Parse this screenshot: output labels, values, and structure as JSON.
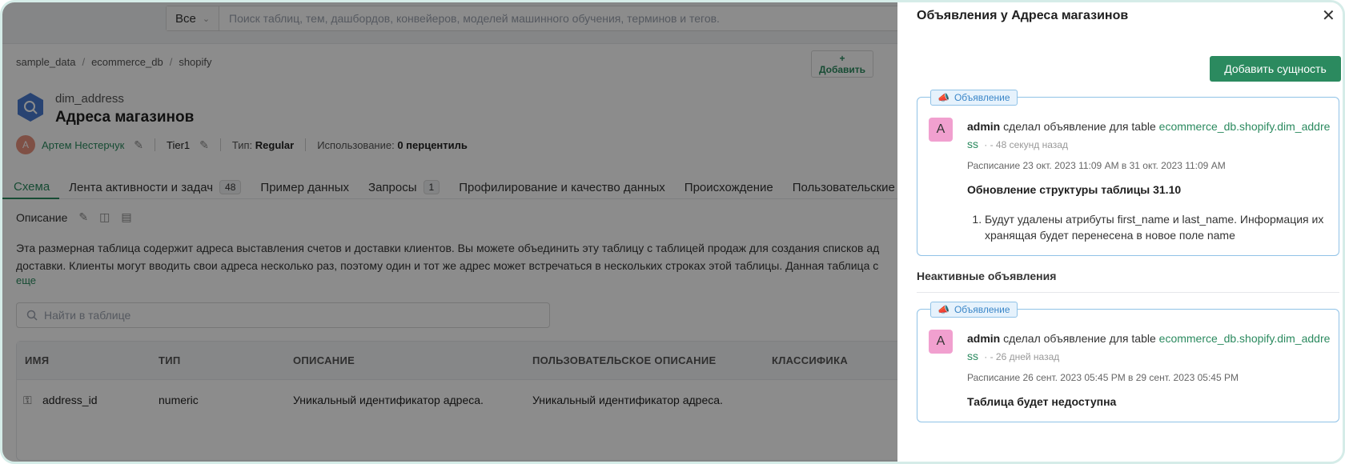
{
  "search": {
    "scope": "Все",
    "placeholder": "Поиск таблиц, тем, дашбордов, конвейеров, моделей машинного обучения, терминов и тегов."
  },
  "breadcrumb": [
    "sample_data",
    "ecommerce_db",
    "shopify"
  ],
  "entity": {
    "name": "dim_address",
    "display_name": "Адреса магазинов"
  },
  "meta": {
    "owner_initial": "А",
    "owner": "Артем Нестерчук",
    "tier": "Tier1",
    "type_label": "Тип:",
    "type_value": "Regular",
    "usage_label": "Использование:",
    "usage_value": "0 перцентиль"
  },
  "tabs": [
    {
      "label": "Схема"
    },
    {
      "label": "Лента активности и задач",
      "count": "48"
    },
    {
      "label": "Пример данных"
    },
    {
      "label": "Запросы",
      "count": "1"
    },
    {
      "label": "Профилирование и качество данных"
    },
    {
      "label": "Происхождение"
    },
    {
      "label": "Пользовательские атри"
    }
  ],
  "description": {
    "label": "Описание",
    "text": "Эта размерная таблица содержит адреса выставления счетов и доставки клиентов. Вы можете объединить эту таблицу с таблицей продаж для создания списков ад доставки. Клиенты могут вводить свои адреса несколько раз, поэтому один и тот же адрес может встречаться в нескольких строках этой таблицы. Данная таблица с",
    "more": "еще"
  },
  "table_search_placeholder": "Найти в таблице",
  "table": {
    "headers": [
      "ИМЯ",
      "ТИП",
      "ОПИСАНИЕ",
      "ПОЛЬЗОВАТЕЛЬСКОЕ ОПИСАНИЕ",
      "КЛАССИФИКА"
    ],
    "row": {
      "name": "address_id",
      "type": "numeric",
      "description": "Уникальный идентификатор адреса.",
      "custom_description": "Уникальный идентификатор адреса.",
      "add_label": "Добавить"
    }
  },
  "drawer": {
    "title": "Объявления у Адреса магазинов",
    "add_button": "Добавить сущность",
    "tag_label": "Объявление",
    "active": {
      "avatar": "A",
      "user": "admin",
      "action": "сделал объявление для table",
      "link": "ecommerce_db.shopify.dim_address",
      "time": "- 48 секунд назад",
      "schedule": "Расписание 23 окт. 2023 11:09 AM в 31 окт. 2023 11:09 AM",
      "heading": "Обновление структуры таблицы 31.10",
      "item": "Будут удалены атрибуты first_name и last_name. Информация их хранящая будет перенесена в новое поле name"
    },
    "inactive_title": "Неактивные объявления",
    "inactive": {
      "avatar": "A",
      "user": "admin",
      "action": "сделал объявление для table",
      "link": "ecommerce_db.shopify.dim_address",
      "time": "- 26 дней назад",
      "schedule": "Расписание 26 сент. 2023 05:45 PM в 29 сент. 2023 05:45 PM",
      "heading": "Таблица будет недоступна"
    }
  },
  "colors": {
    "accent": "#2b8a5f",
    "announcement_border": "#90c2e7",
    "avatar": "#f1a0cf"
  }
}
